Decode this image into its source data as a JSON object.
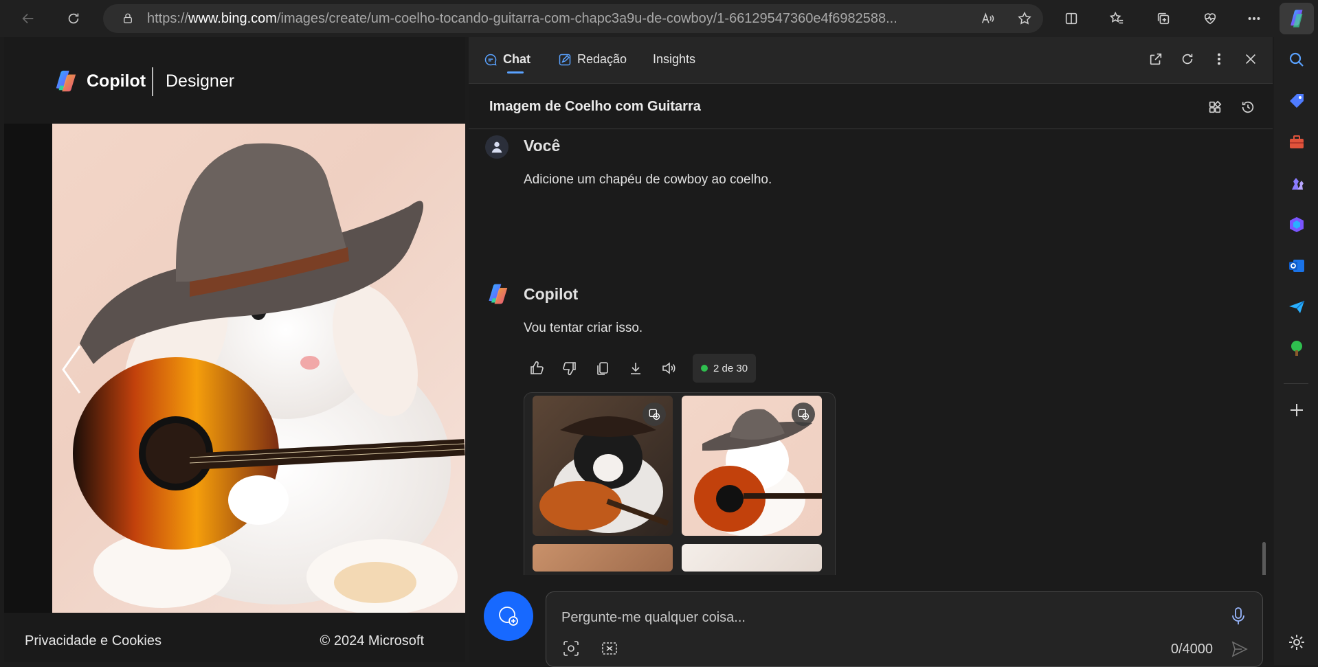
{
  "browser": {
    "url_prefix": "https://",
    "url_domain": "www.bing.com",
    "url_path": "/images/create/um-coelho-tocando-guitarra-com-chapc3a9u-de-cowboy/1-66129547360e4f6982588..."
  },
  "designer": {
    "brand": "Copilot",
    "product": "Designer",
    "footer_privacy": "Privacidade e Cookies",
    "footer_copyright": "© 2024 Microsoft"
  },
  "sidebar": {
    "tabs": [
      {
        "label": "Chat"
      },
      {
        "label": "Redação"
      },
      {
        "label": "Insights"
      }
    ],
    "conversation_title": "Imagem de Coelho com Guitarra"
  },
  "messages": {
    "user_author": "Você",
    "user_text": "Adicione um chapéu de cowboy ao coelho.",
    "bot_author": "Copilot",
    "bot_text": "Vou tentar criar isso.",
    "counter": "2 de 30"
  },
  "composer": {
    "placeholder": "Pergunte-me qualquer coisa...",
    "char_count": "0/4000"
  },
  "colors": {
    "accent": "#1769ff",
    "tab_accent": "#5aa2ff",
    "status_dot": "#2fbf4f"
  }
}
